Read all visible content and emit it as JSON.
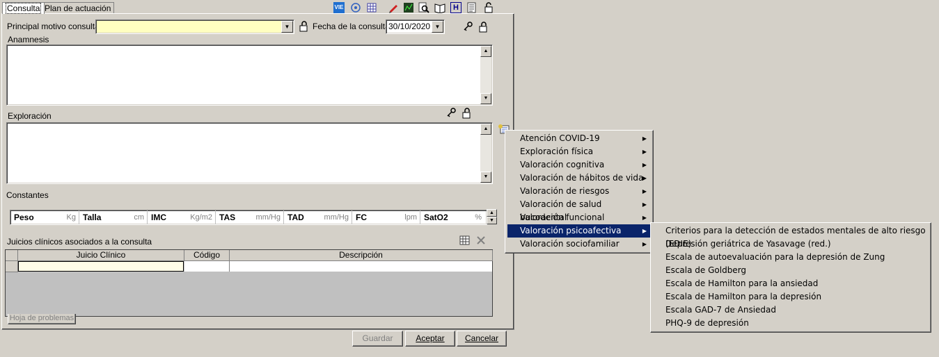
{
  "tabs": [
    "Consulta",
    "Plan de actuación"
  ],
  "toolbar_icons": [
    "vie-icon",
    "network-icon",
    "grid-icon",
    "pen-icon",
    "chart-icon",
    "search-doc-icon",
    "book-icon",
    "h-icon",
    "document-icon",
    "lock-icon"
  ],
  "vie_label": "VIE",
  "h_label": "H",
  "form": {
    "motivo_label": "Principal motivo consulta:",
    "motivo_value": "",
    "fecha_label": "Fecha de la consulta:",
    "fecha_value": "30/10/2020",
    "anamnesis_label": "Anamnesis",
    "exploracion_label": "Exploración",
    "constantes_label": "Constantes"
  },
  "constantes": [
    {
      "label": "Peso",
      "unit": "Kg"
    },
    {
      "label": "Talla",
      "unit": "cm"
    },
    {
      "label": "IMC",
      "unit": "Kg/m2"
    },
    {
      "label": "TAS",
      "unit": "mm/Hg"
    },
    {
      "label": "TAD",
      "unit": "mm/Hg"
    },
    {
      "label": "FC",
      "unit": "lpm"
    },
    {
      "label": "SatO2",
      "unit": "%"
    }
  ],
  "juicios": {
    "title": "Juicios clínicos asociados a la consulta",
    "columns": [
      "Juicio Clínico",
      "Código",
      "Descripción"
    ],
    "hoja_button": "Hoja de problemas"
  },
  "buttons": {
    "guardar": "Guardar",
    "aceptar": "Aceptar",
    "cancelar": "Cancelar"
  },
  "menu": [
    "Atención COVID-19",
    "Exploración física",
    "Valoración cognitiva",
    "Valoración de hábitos de vida",
    "Valoración de riesgos",
    "Valoración de salud bucodental",
    "Valoración funcional",
    "Valoración psicoafectiva",
    "Valoración sociofamiliar"
  ],
  "menu_selected": "Valoración psicoafectiva",
  "submenu": [
    "Criterios para la detección de estados mentales de alto riesgo (EDIE)",
    "Depresión geriátrica de Yasavage (red.)",
    "Escala de autoevaluación para la depresión de Zung",
    "Escala de Goldberg",
    "Escala de Hamilton para la ansiedad",
    "Escala de Hamilton para la depresión",
    "Escala GAD-7 de Ansiedad",
    "PHQ-9 de depresión"
  ]
}
